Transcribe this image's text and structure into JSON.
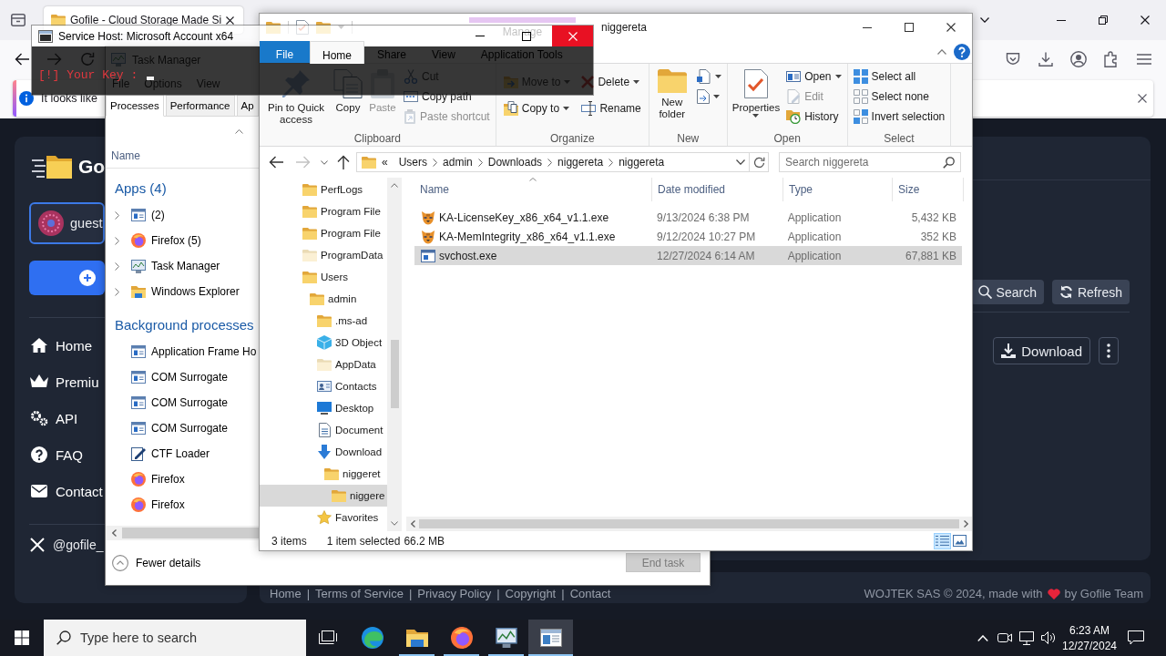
{
  "browser": {
    "tab": {
      "title": "Gofile - Cloud Storage Made Si",
      "selected": true
    },
    "notification": {
      "text": "It looks like"
    },
    "page": {
      "brand": "Go",
      "user": "guest",
      "menu": [
        {
          "kind": "home",
          "label": "Home"
        },
        {
          "kind": "premium",
          "label": "Premiu"
        },
        {
          "kind": "api",
          "label": "API"
        },
        {
          "kind": "faq",
          "label": "FAQ"
        },
        {
          "kind": "contact",
          "label": "Contact"
        }
      ],
      "social": "@gofile_",
      "actions": [
        {
          "kind": "search",
          "label": "Search"
        },
        {
          "kind": "refresh",
          "label": "Refresh"
        }
      ],
      "download": "Download",
      "footer": {
        "links": [
          "Home",
          "Terms of Service",
          "Privacy Policy",
          "Copyright",
          "Contact"
        ],
        "separator": "|",
        "credit_before": "WOJTEK SAS © 2024, made with",
        "credit_after": "by Gofile Team"
      }
    }
  },
  "task_manager": {
    "title": "Task Manager",
    "menu": [
      "File",
      "Options",
      "View"
    ],
    "tabs": [
      {
        "label": "Processes",
        "selected": true
      },
      {
        "label": "Performance",
        "selected": false
      },
      {
        "label": "Ap",
        "selected": false
      }
    ],
    "column": "Name",
    "groups": [
      {
        "title": "Apps (4)",
        "processes": [
          {
            "name": "(2)",
            "kind": "window",
            "expandable": true
          },
          {
            "name": "Firefox (5)",
            "kind": "firefox",
            "expandable": true
          },
          {
            "name": "Task Manager",
            "kind": "monitor",
            "expandable": true
          },
          {
            "name": "Windows Explorer",
            "kind": "explorer",
            "expandable": true
          }
        ]
      },
      {
        "title": "Background processes",
        "processes": [
          {
            "name": "Application Frame Ho",
            "kind": "window",
            "expandable": false
          },
          {
            "name": "COM Surrogate",
            "kind": "window",
            "expandable": false
          },
          {
            "name": "COM Surrogate",
            "kind": "window",
            "expandable": false
          },
          {
            "name": "COM Surrogate",
            "kind": "window",
            "expandable": false
          },
          {
            "name": "CTF Loader",
            "kind": "pen",
            "expandable": false
          },
          {
            "name": "Firefox",
            "kind": "firefox",
            "expandable": false
          },
          {
            "name": "Firefox",
            "kind": "firefox",
            "expandable": false
          }
        ]
      }
    ],
    "fewer_details": "Fewer details",
    "end_task": {
      "label": "End task",
      "disabled": true
    }
  },
  "explorer": {
    "title": "niggereta",
    "ribbon": {
      "context": "Manage",
      "tabs": [
        {
          "label": "File",
          "kind": "file",
          "selected": false
        },
        {
          "label": "Home",
          "kind": "tab",
          "selected": true
        },
        {
          "label": "Share",
          "kind": "tab",
          "selected": false
        },
        {
          "label": "View",
          "kind": "tab",
          "selected": false
        },
        {
          "label": "Application Tools",
          "kind": "tab",
          "selected": false
        }
      ],
      "groups": [
        {
          "label": "Clipboard",
          "columns": [
            {
              "kind": "large",
              "items": [
                {
                  "kind": "pin",
                  "label": "Pin to Quick access",
                  "disabled": false,
                  "dropdown": false
                }
              ]
            },
            {
              "kind": "large",
              "items": [
                {
                  "kind": "copy",
                  "label": "Copy",
                  "disabled": false,
                  "dropdown": false
                }
              ]
            },
            {
              "kind": "large",
              "items": [
                {
                  "kind": "paste",
                  "label": "Paste",
                  "disabled": true,
                  "dropdown": false
                }
              ]
            },
            {
              "kind": "stack",
              "items": [
                {
                  "kind": "cut",
                  "label": "Cut",
                  "disabled": false,
                  "dropdown": false
                },
                {
                  "kind": "copy-path",
                  "label": "Copy path",
                  "disabled": false,
                  "dropdown": false
                },
                {
                  "kind": "paste-shortcut",
                  "label": "Paste shortcut",
                  "disabled": true,
                  "dropdown": false
                }
              ]
            }
          ]
        },
        {
          "label": "Organize",
          "columns": [
            {
              "kind": "wide-stack",
              "items": [
                {
                  "kind": "move-to",
                  "label": "Move to",
                  "disabled": false,
                  "dropdown": true
                },
                {
                  "kind": "copy-to",
                  "label": "Copy to",
                  "disabled": false,
                  "dropdown": true
                }
              ]
            },
            {
              "kind": "wide-stack",
              "items": [
                {
                  "kind": "delete",
                  "label": "Delete",
                  "disabled": false,
                  "dropdown": true
                },
                {
                  "kind": "rename",
                  "label": "Rename",
                  "disabled": false,
                  "dropdown": false
                }
              ]
            }
          ]
        },
        {
          "label": "New",
          "columns": [
            {
              "kind": "large",
              "items": [
                {
                  "kind": "new-folder",
                  "label": "New folder",
                  "disabled": false,
                  "dropdown": false
                }
              ]
            },
            {
              "kind": "stack",
              "items": [
                {
                  "kind": "new-item",
                  "disabled": false,
                  "dropdown": true
                },
                {
                  "kind": "easy-access",
                  "disabled": false,
                  "dropdown": true
                }
              ]
            }
          ]
        },
        {
          "label": "Open",
          "columns": [
            {
              "kind": "large",
              "items": [
                {
                  "kind": "properties",
                  "label": "Properties",
                  "disabled": false,
                  "dropdown": true
                }
              ]
            },
            {
              "kind": "stack",
              "items": [
                {
                  "kind": "open",
                  "label": "Open",
                  "disabled": false,
                  "dropdown": true
                },
                {
                  "kind": "edit",
                  "label": "Edit",
                  "disabled": true,
                  "dropdown": false
                },
                {
                  "kind": "history",
                  "label": "History",
                  "disabled": false,
                  "dropdown": false
                }
              ]
            }
          ]
        },
        {
          "label": "Select",
          "columns": [
            {
              "kind": "stack",
              "items": [
                {
                  "kind": "select-all",
                  "label": "Select all",
                  "disabled": false,
                  "dropdown": false
                },
                {
                  "kind": "select-none",
                  "label": "Select none",
                  "disabled": false,
                  "dropdown": false
                },
                {
                  "kind": "invert",
                  "label": "Invert selection",
                  "disabled": false,
                  "dropdown": false
                }
              ]
            }
          ]
        }
      ]
    },
    "address": {
      "lead": "«",
      "crumbs": [
        "Users",
        "admin",
        "Downloads",
        "niggereta",
        "niggereta"
      ]
    },
    "search": {
      "placeholder": "Search niggereta"
    },
    "tree": [
      {
        "label": "PerfLogs",
        "kind": "folder",
        "selected": false
      },
      {
        "label": "Program File",
        "kind": "folder",
        "selected": false
      },
      {
        "label": "Program File",
        "kind": "folder",
        "selected": false
      },
      {
        "label": "ProgramData",
        "kind": "hidden-folder",
        "selected": false
      },
      {
        "label": "Users",
        "kind": "folder",
        "selected": false,
        "children": [
          {
            "label": "admin",
            "kind": "folder",
            "selected": false,
            "children": [
              {
                "label": ".ms-ad",
                "kind": "folder",
                "selected": false
              },
              {
                "label": "3D Object",
                "kind": "cube",
                "selected": false
              },
              {
                "label": "AppData",
                "kind": "hidden-folder",
                "selected": false
              },
              {
                "label": "Contacts",
                "kind": "contacts",
                "selected": false
              },
              {
                "label": "Desktop",
                "kind": "desktop",
                "selected": false
              },
              {
                "label": "Document",
                "kind": "documents",
                "selected": false
              },
              {
                "label": "Download",
                "kind": "downloads",
                "selected": false,
                "children": [
                  {
                    "label": "niggeret",
                    "kind": "folder",
                    "selected": false,
                    "children": [
                      {
                        "label": "niggere",
                        "kind": "folder",
                        "selected": true
                      }
                    ]
                  }
                ]
              },
              {
                "label": "Favorites",
                "kind": "star",
                "selected": false
              }
            ]
          }
        ]
      }
    ],
    "columns": [
      "Name",
      "Date modified",
      "Type",
      "Size"
    ],
    "files": [
      {
        "name": "KA-LicenseKey_x86_x64_v1.1.exe",
        "date": "9/13/2024 6:38 PM",
        "type": "Application",
        "size": "5,432 KB",
        "kind": "cat",
        "selected": false
      },
      {
        "name": "KA-MemIntegrity_x86_x64_v1.1.exe",
        "date": "9/12/2024 10:27 PM",
        "type": "Application",
        "size": "352 KB",
        "kind": "cat",
        "selected": false
      },
      {
        "name": "svchost.exe",
        "date": "12/27/2024 6:14 AM",
        "type": "Application",
        "size": "67,881 KB",
        "kind": "app",
        "selected": true
      }
    ],
    "status": {
      "count": "3 items",
      "selection": "1 item selected",
      "size": "66.2 MB"
    },
    "views": [
      {
        "kind": "details",
        "selected": true
      },
      {
        "kind": "large-icons",
        "selected": false
      }
    ]
  },
  "console": {
    "title": "Service Host: Microsoft Account x64",
    "text": "[!] Your Key :"
  },
  "taskbar": {
    "search": {
      "placeholder": "Type here to search"
    },
    "apps": [
      {
        "kind": "edge",
        "running": false,
        "selected": false
      },
      {
        "kind": "explorer",
        "running": true,
        "selected": false
      },
      {
        "kind": "firefox",
        "running": true,
        "selected": false
      },
      {
        "kind": "task-manager",
        "running": true,
        "selected": false
      },
      {
        "kind": "console",
        "running": true,
        "selected": true
      }
    ],
    "clock": {
      "time": "6:23 AM",
      "date": "12/27/2024"
    }
  }
}
